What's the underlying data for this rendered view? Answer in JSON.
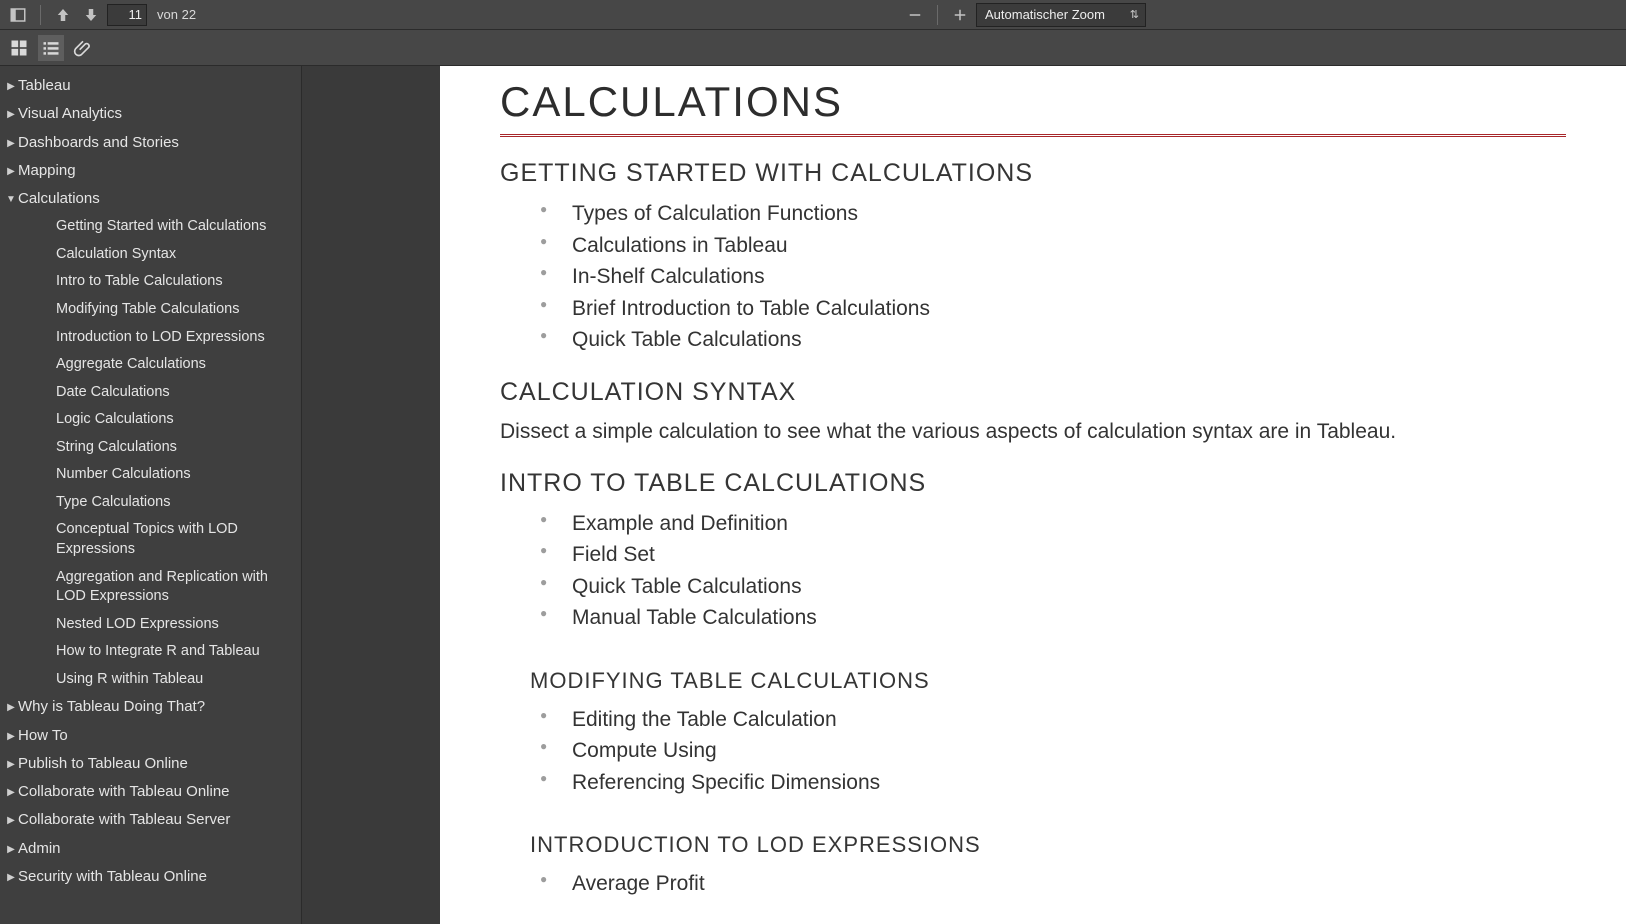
{
  "toolbar": {
    "page_current": "11",
    "page_of_prefix": "von",
    "page_total": "22",
    "zoom_label": "Automatischer Zoom"
  },
  "outline": {
    "items": [
      {
        "label": "Tableau",
        "expanded": false,
        "children": []
      },
      {
        "label": "Visual Analytics",
        "expanded": false,
        "children": []
      },
      {
        "label": "Dashboards and Stories",
        "expanded": false,
        "children": []
      },
      {
        "label": "Mapping",
        "expanded": false,
        "children": []
      },
      {
        "label": "Calculations",
        "expanded": true,
        "children": [
          "Getting Started with Calculations",
          "Calculation Syntax",
          "Intro to Table Calculations",
          "Modifying Table Calculations",
          "Introduction to LOD Expressions",
          "Aggregate Calculations",
          "Date Calculations",
          "Logic Calculations",
          "String Calculations",
          "Number Calculations",
          "Type Calculations",
          "Conceptual Topics with LOD Expressions",
          "Aggregation and Replication with LOD Expressions",
          "Nested LOD Expressions",
          "How to Integrate R and Tableau",
          "Using R within Tableau"
        ]
      },
      {
        "label": "Why is Tableau Doing That?",
        "expanded": false,
        "children": []
      },
      {
        "label": "How To",
        "expanded": false,
        "children": []
      },
      {
        "label": "Publish to Tableau Online",
        "expanded": false,
        "children": []
      },
      {
        "label": "Collaborate with Tableau Online",
        "expanded": false,
        "children": []
      },
      {
        "label": "Collaborate with Tableau Server",
        "expanded": false,
        "children": []
      },
      {
        "label": "Admin",
        "expanded": false,
        "children": []
      },
      {
        "label": "Security with Tableau Online",
        "expanded": false,
        "children": []
      }
    ]
  },
  "doc": {
    "title": "CALCULATIONS",
    "sections": [
      {
        "heading": "GETTING STARTED WITH CALCULATIONS",
        "bullets": [
          "Types of Calculation Functions",
          "Calculations in Tableau",
          "In-Shelf Calculations",
          "Brief Introduction to Table Calculations",
          "Quick Table Calculations"
        ]
      },
      {
        "heading": "CALCULATION SYNTAX",
        "paragraph": "Dissect a simple calculation to see what the various aspects of calculation syntax are in Tableau."
      },
      {
        "heading": "INTRO TO TABLE CALCULATIONS",
        "bullets": [
          "Example and Definition",
          "Field Set",
          "Quick Table Calculations",
          "Manual Table Calculations"
        ]
      },
      {
        "heading_sub": "MODIFYING TABLE CALCULATIONS",
        "bullets": [
          "Editing the Table Calculation",
          "Compute Using",
          "Referencing Specific Dimensions"
        ]
      },
      {
        "heading_sub": "INTRODUCTION TO LOD EXPRESSIONS",
        "bullets": [
          "Average Profit"
        ]
      }
    ]
  }
}
